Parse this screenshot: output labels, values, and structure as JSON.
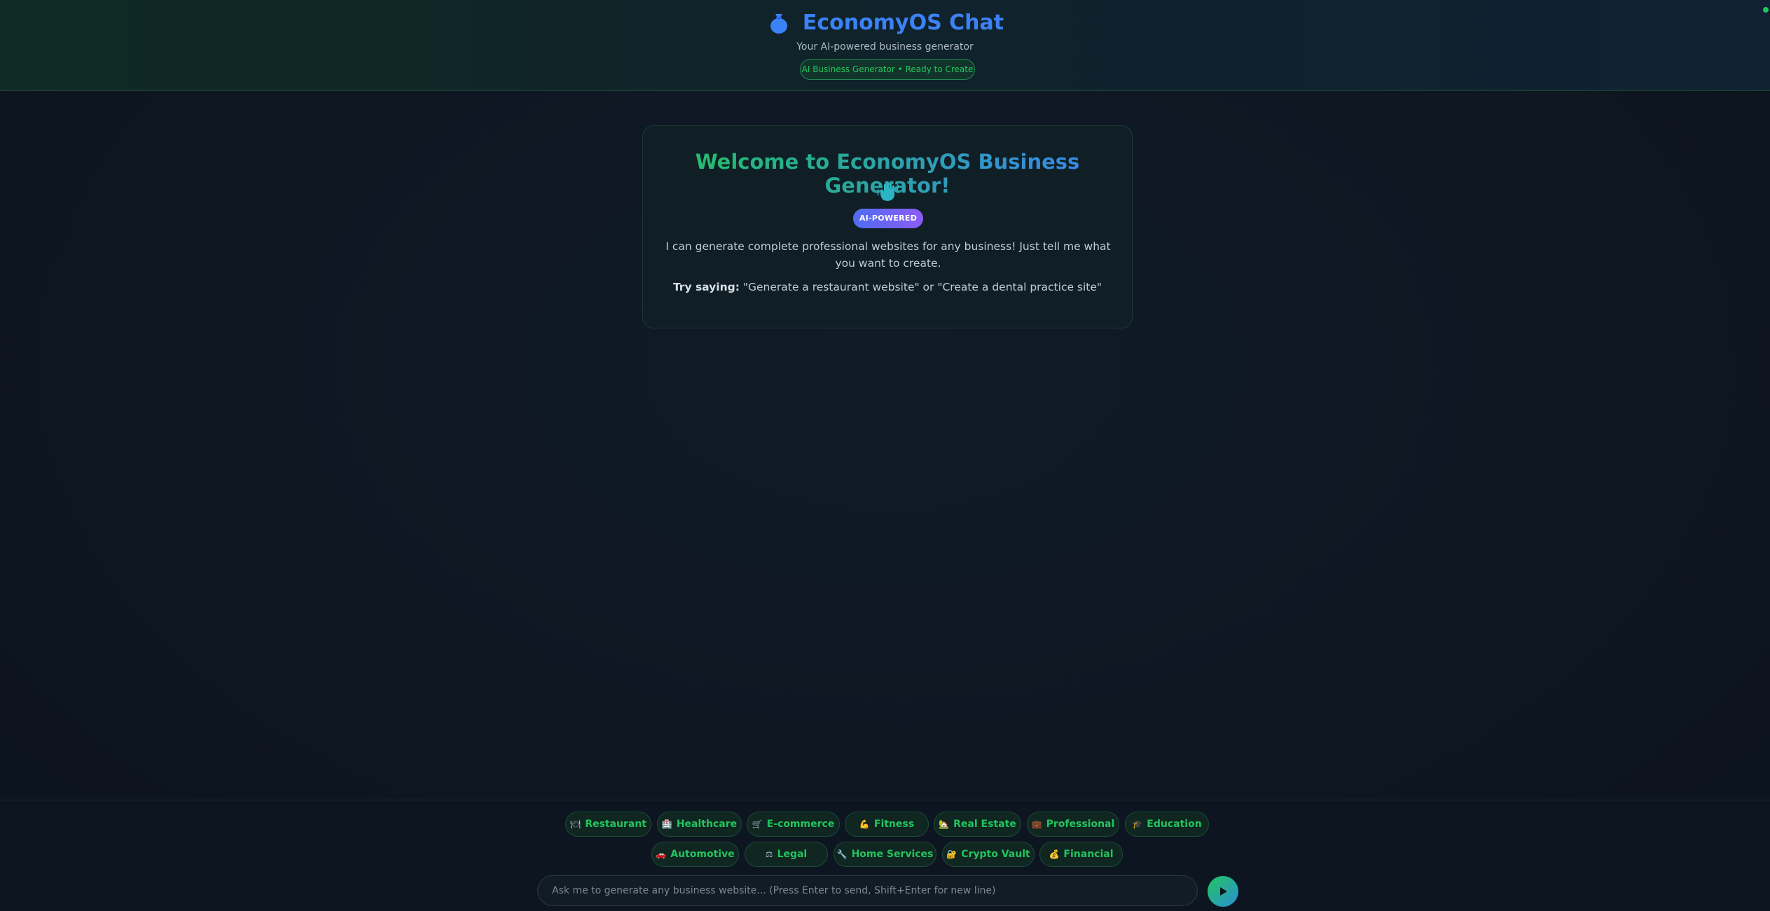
{
  "header": {
    "title": "EconomyOS Chat",
    "subtitle": "Your AI-powered business generator",
    "status": "AI Business Generator • Ready to Create",
    "icon": "money-bag-icon"
  },
  "welcome": {
    "title": "Welcome to EconomyOS Business Generator!",
    "badge": "AI-POWERED",
    "description": "I can generate complete professional websites for any business! Just tell me what you want to create.",
    "try_label": "Try saying:",
    "try_text": " \"Generate a restaurant website\" or \"Create a dental practice site\""
  },
  "chips": [
    {
      "label": "Restaurant",
      "icon": "🍽"
    },
    {
      "label": "Healthcare",
      "icon": "🏥"
    },
    {
      "label": "E-commerce",
      "icon": "🛒"
    },
    {
      "label": "Fitness",
      "icon": "💪"
    },
    {
      "label": "Real Estate",
      "icon": "🏡"
    },
    {
      "label": "Professional",
      "icon": "💼"
    },
    {
      "label": "Education",
      "icon": "🎓"
    },
    {
      "label": "Automotive",
      "icon": "🚗"
    },
    {
      "label": "Legal",
      "icon": "⚖"
    },
    {
      "label": "Home Services",
      "icon": "🔧"
    },
    {
      "label": "Crypto Vault",
      "icon": "🔐"
    },
    {
      "label": "Financial",
      "icon": "💰"
    }
  ],
  "input": {
    "placeholder": "Ask me to generate any business website... (Press Enter to send, Shift+Enter for new line)"
  },
  "colors": {
    "accent_green": "#22c55e",
    "accent_blue": "#3b82f6",
    "badge_purple": "#8b5cf6",
    "background": "#0f1722"
  }
}
